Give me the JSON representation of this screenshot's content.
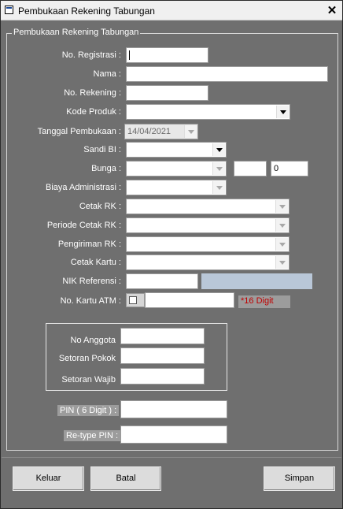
{
  "window": {
    "title": "Pembukaan Rekening Tabungan",
    "close_label": "✕"
  },
  "group": {
    "legend": "Pembukaan Rekening Tabungan"
  },
  "fields": {
    "no_registrasi": {
      "label": "No. Registrasi :",
      "value": ""
    },
    "nama": {
      "label": "Nama :",
      "value": ""
    },
    "no_rekening": {
      "label": "No. Rekening :",
      "value": ""
    },
    "kode_produk": {
      "label": "Kode Produk :",
      "value": ""
    },
    "tanggal_pembukaan": {
      "label": "Tanggal Pembukaan :",
      "value": "14/04/2021"
    },
    "sandi_bi": {
      "label": "Sandi BI :",
      "value": ""
    },
    "bunga": {
      "label": "Bunga :",
      "value": "",
      "extra1": "",
      "extra2": "0"
    },
    "biaya_administrasi": {
      "label": "Biaya Administrasi :",
      "value": ""
    },
    "cetak_rk": {
      "label": "Cetak RK :",
      "value": ""
    },
    "periode_cetak_rk": {
      "label": "Periode Cetak RK :",
      "value": ""
    },
    "pengiriman_rk": {
      "label": "Pengiriman RK :",
      "value": ""
    },
    "cetak_kartu": {
      "label": "Cetak Kartu :",
      "value": ""
    },
    "nik_referensi": {
      "label": "NIK Referensi :",
      "value": "",
      "name_value": ""
    },
    "no_kartu_atm": {
      "label": "No. Kartu ATM :",
      "value": "",
      "hint": "*16 Digit"
    }
  },
  "anggota": {
    "no_anggota": {
      "label": "No Anggota",
      "value": ""
    },
    "setoran_pokok": {
      "label": "Setoran Pokok",
      "value": ""
    },
    "setoran_wajib": {
      "label": "Setoran Wajib",
      "value": ""
    }
  },
  "pin": {
    "pin": {
      "label": "PIN ( 6 Digit ) :",
      "value": ""
    },
    "retype": {
      "label": "Re-type PIN :",
      "value": ""
    }
  },
  "buttons": {
    "keluar": "Keluar",
    "batal": "Batal",
    "simpan": "Simpan"
  }
}
